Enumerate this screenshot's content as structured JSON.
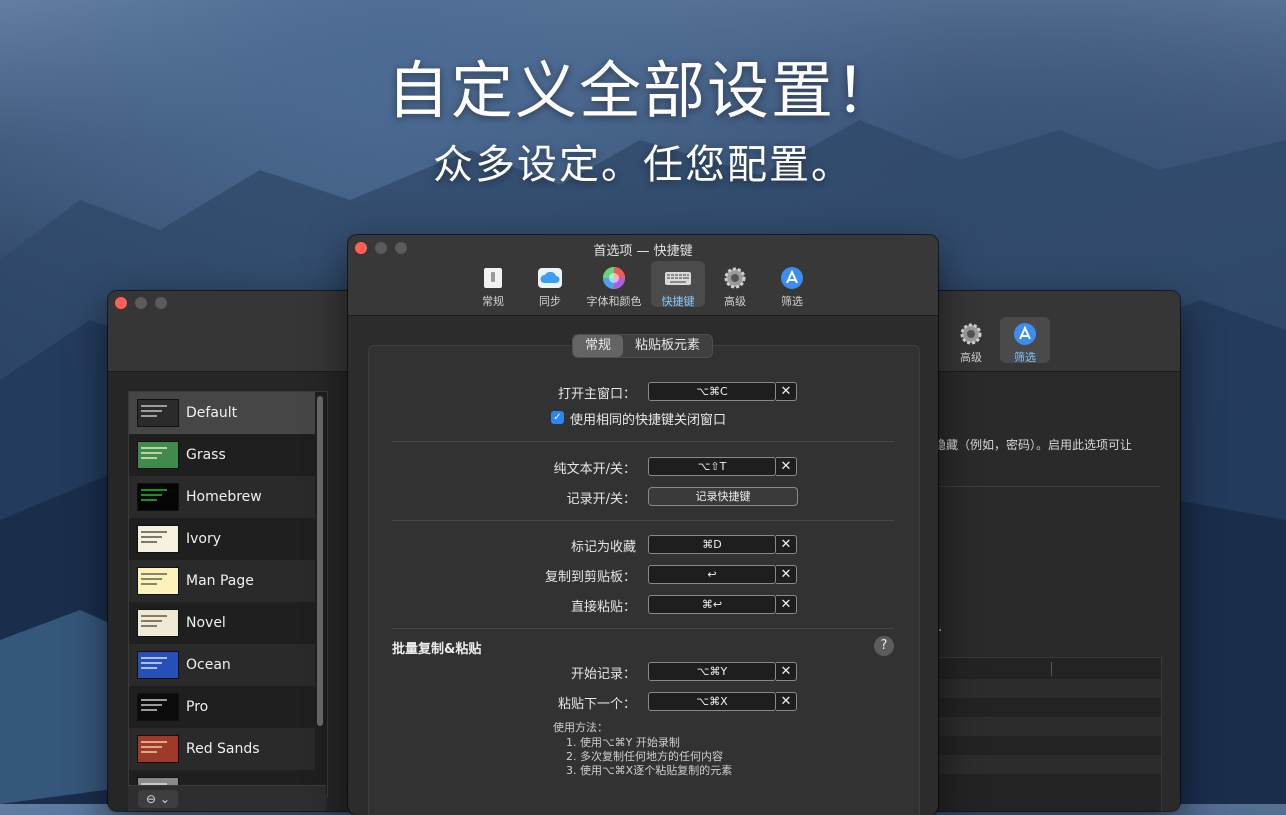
{
  "hero": {
    "title": "自定义全部设置！",
    "subtitle": "众多设定。任您配置。"
  },
  "left_window": {
    "themes": [
      {
        "name": "Default",
        "swatch": "#2b2b2b",
        "lines": "#cfcfcf"
      },
      {
        "name": "Grass",
        "swatch": "#3f8a4c",
        "lines": "#f3f3c8"
      },
      {
        "name": "Homebrew",
        "swatch": "#050505",
        "lines": "#22d12a"
      },
      {
        "name": "Ivory",
        "swatch": "#f5f1dd",
        "lines": "#444444"
      },
      {
        "name": "Man Page",
        "swatch": "#fdf2b8",
        "lines": "#555555"
      },
      {
        "name": "Novel",
        "swatch": "#efe9d6",
        "lines": "#5a4a3a"
      },
      {
        "name": "Ocean",
        "swatch": "#2650b8",
        "lines": "#e6ecff"
      },
      {
        "name": "Pro",
        "swatch": "#0c0c0c",
        "lines": "#d8d8d8"
      },
      {
        "name": "Red Sands",
        "swatch": "#9e3a2a",
        "lines": "#f4d9b0"
      },
      {
        "name": "",
        "swatch": "#8a8a8a",
        "lines": "#e0e0e0"
      }
    ],
    "footer_button": "⊖ ⌄"
  },
  "right_window": {
    "toolbar": [
      {
        "label": "高级",
        "icon": "gear-icon"
      },
      {
        "label": "筛选",
        "icon": "app-store-icon"
      }
    ],
    "desc_text": "隐藏（例如，密码）。启用此选项可让",
    "dot_text": "."
  },
  "main_window": {
    "title": "首选项 — 快捷键",
    "toolbar": [
      {
        "label": "常规",
        "icon": "general-switch-icon"
      },
      {
        "label": "同步",
        "icon": "cloud-icon"
      },
      {
        "label": "字体和颜色",
        "icon": "color-wheel-icon"
      },
      {
        "label": "快捷键",
        "icon": "keyboard-icon"
      },
      {
        "label": "高级",
        "icon": "gear-icon"
      },
      {
        "label": "筛选",
        "icon": "app-store-icon"
      }
    ],
    "active_tool": "快捷键",
    "segments": [
      "常规",
      "粘贴板元素"
    ],
    "active_segment": "常规",
    "rows": {
      "open_main": {
        "label": "打开主窗口：",
        "shortcut": "⌥⌘C",
        "clear": "✕"
      },
      "close_same_checkbox": {
        "label": "使用相同的快捷键关闭窗口",
        "checked": true,
        "mark": "✓"
      },
      "plain_text": {
        "label": "纯文本开/关：",
        "shortcut": "⌥⇧T",
        "clear": "✕"
      },
      "record": {
        "label": "记录开/关：",
        "button": "记录快捷键"
      },
      "favorite": {
        "label": "标记为收藏",
        "shortcut": "⌘D",
        "clear": "✕"
      },
      "copy_clipboard": {
        "label": "复制到剪贴板：",
        "shortcut": "↩",
        "clear": "✕"
      },
      "paste_direct": {
        "label": "直接粘贴：",
        "shortcut": "⌘↩",
        "clear": "✕"
      },
      "start_record": {
        "label": "开始记录：",
        "shortcut": "⌥⌘Y",
        "clear": "✕"
      },
      "paste_next": {
        "label": "粘贴下一个：",
        "shortcut": "⌥⌘X",
        "clear": "✕"
      }
    },
    "batch_section": {
      "title": "批量复制&粘贴",
      "help": "?"
    },
    "usage": {
      "heading": "使用方法：",
      "steps": [
        "1. 使用⌥⌘Y 开始录制",
        "2. 多次复制任何地方的任何内容",
        "3. 使用⌥⌘X逐个粘贴复制的元素"
      ]
    }
  },
  "colors": {
    "accent": "#86c8ff",
    "checkbox": "#2d86f0",
    "close_button": "#ff5f57"
  }
}
